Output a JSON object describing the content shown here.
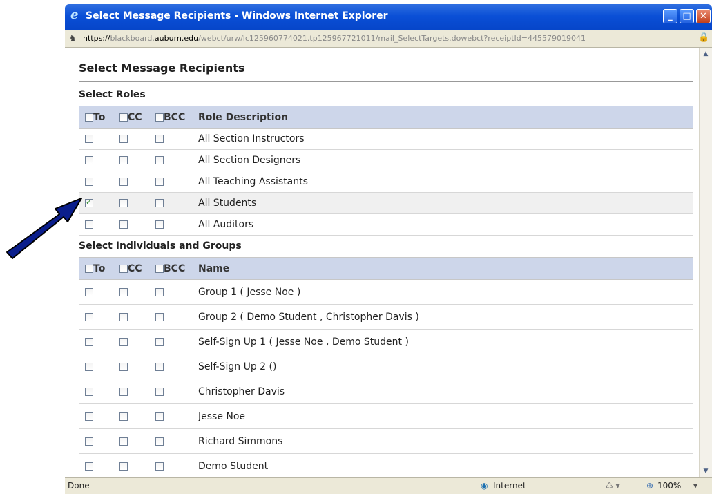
{
  "window": {
    "title": "Select Message Recipients - Windows Internet Explorer",
    "controls": {
      "minimize": "_",
      "maximize": "□",
      "close": "✕"
    }
  },
  "address": {
    "prefix": "https://",
    "host_pre": "blackboard.",
    "domain": "auburn.edu",
    "path": "/webct/urw/lc125960774021.tp125967721011/mail_SelectTargets.dowebct?receiptId=445579019041"
  },
  "page": {
    "heading": "Select Message Recipients",
    "roles_heading": "Select Roles",
    "individuals_heading": "Select Individuals and Groups"
  },
  "roles_table": {
    "headers": {
      "to": "To",
      "cc": "CC",
      "bcc": "BCC",
      "desc": "Role Description"
    },
    "rows": [
      {
        "label": "All Section Instructors",
        "to": false,
        "cc": false,
        "bcc": false
      },
      {
        "label": "All Section Designers",
        "to": false,
        "cc": false,
        "bcc": false
      },
      {
        "label": "All Teaching Assistants",
        "to": false,
        "cc": false,
        "bcc": false
      },
      {
        "label": "All Students",
        "to": true,
        "cc": false,
        "bcc": false
      },
      {
        "label": "All Auditors",
        "to": false,
        "cc": false,
        "bcc": false
      }
    ]
  },
  "individuals_table": {
    "headers": {
      "to": "To",
      "cc": "CC",
      "bcc": "BCC",
      "name": "Name"
    },
    "rows": [
      {
        "label": "Group 1 ( Jesse Noe )"
      },
      {
        "label": "Group 2 ( Demo Student , Christopher Davis )"
      },
      {
        "label": "Self-Sign Up 1 ( Jesse Noe , Demo Student )"
      },
      {
        "label": "Self-Sign Up 2 ()"
      },
      {
        "label": "Christopher Davis"
      },
      {
        "label": "Jesse Noe"
      },
      {
        "label": "Richard Simmons"
      },
      {
        "label": "Demo Student"
      }
    ]
  },
  "status_bar": {
    "left": "Done",
    "zone": "Internet",
    "zoom": "100%"
  },
  "colors": {
    "titlebar": "#0a4fd6",
    "header_row": "#cdd6ea",
    "arrow": "#0a1e8c"
  }
}
